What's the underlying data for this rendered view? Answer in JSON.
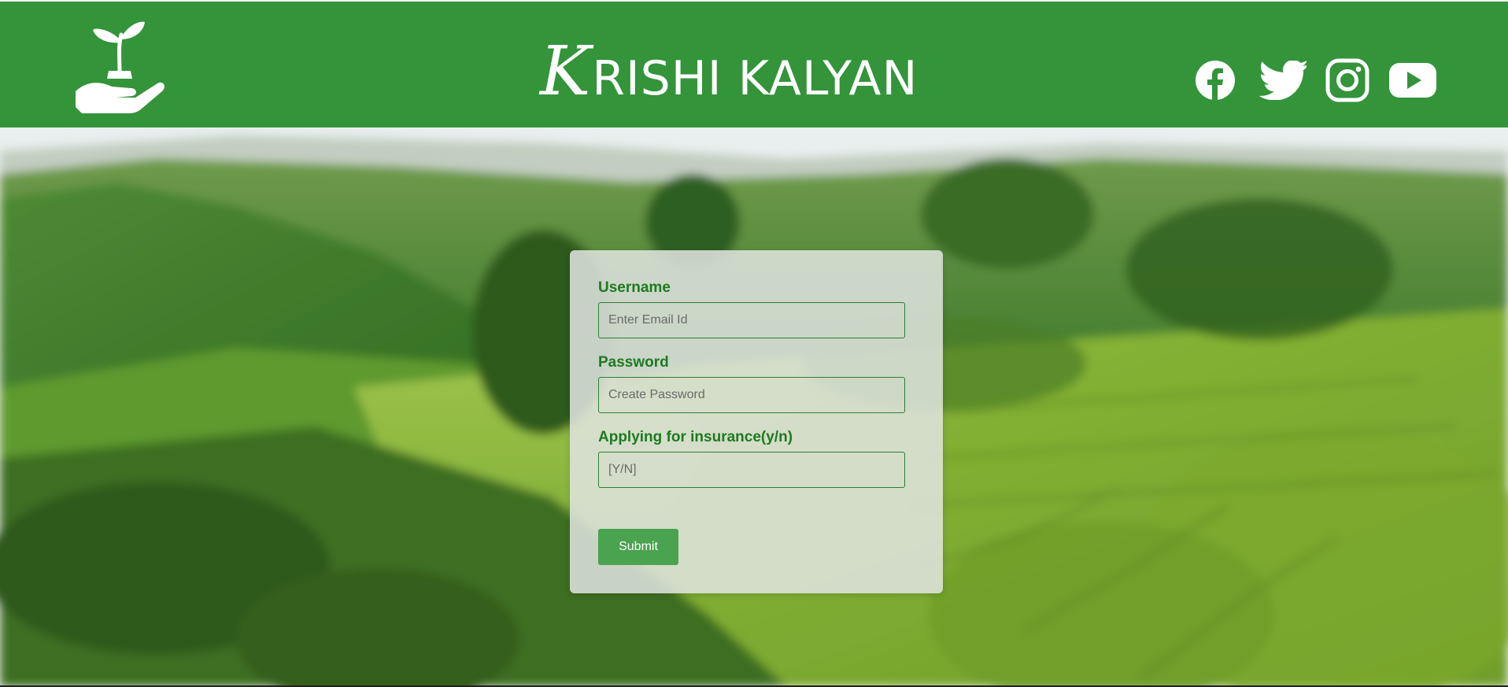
{
  "header": {
    "brand_initial": "K",
    "brand_rest": "RISHI KALYAN",
    "logo_icon": "sprout-in-hand-icon",
    "socials": [
      {
        "name": "facebook-icon"
      },
      {
        "name": "twitter-icon"
      },
      {
        "name": "instagram-icon"
      },
      {
        "name": "youtube-icon"
      }
    ]
  },
  "form": {
    "username_label": "Username",
    "username_placeholder": "Enter Email Id",
    "password_label": "Password",
    "password_placeholder": "Create Password",
    "insurance_label": "Applying for insurance(y/n)",
    "insurance_placeholder": "[Y/N]",
    "submit_label": "Submit"
  },
  "colors": {
    "header_bg": "#33943a",
    "label_green": "#1e7a22",
    "button_green": "#4aa34f"
  }
}
